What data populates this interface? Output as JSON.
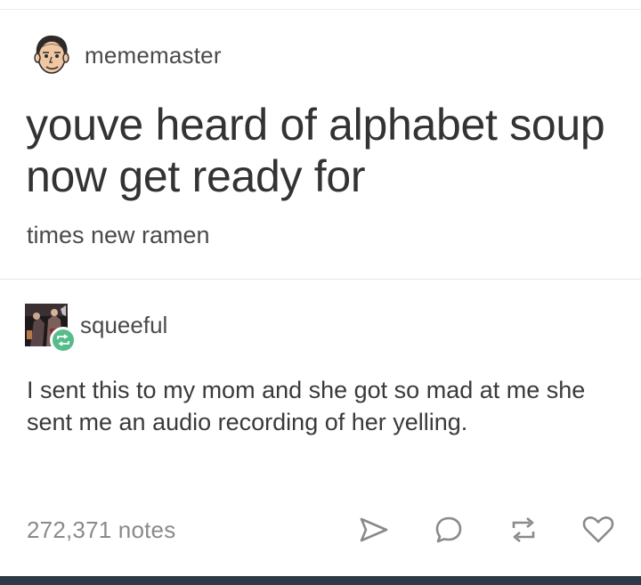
{
  "post": {
    "author": "mememaster",
    "title": "youve heard of alphabet soup now get ready for",
    "body": "times new ramen"
  },
  "reblog": {
    "author": "squeeful",
    "text": "I sent this to my mom and she got so mad at me she sent me an audio recording of her yelling."
  },
  "footer": {
    "notes": "272,371 notes",
    "actions": [
      "share-icon",
      "reply-icon",
      "reblog-icon",
      "like-icon"
    ]
  },
  "colors": {
    "reblog_badge": "#56bc8a",
    "icon_gray": "#8a8a8a",
    "bottom_bar": "#2e3948"
  }
}
